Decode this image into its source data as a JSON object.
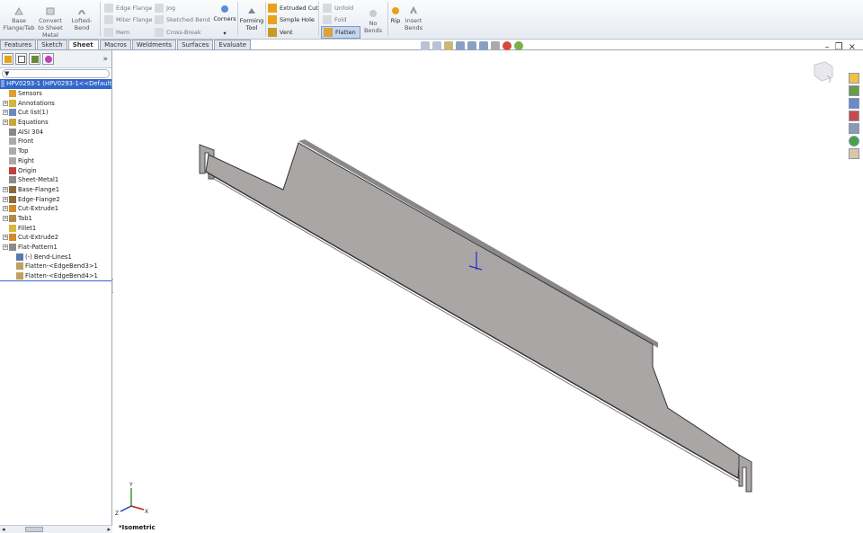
{
  "ribbon": {
    "big_buttons": [
      {
        "label": "Base Flange/Tab",
        "icon": "base-flange-icon"
      },
      {
        "label": "Convert to Sheet Metal",
        "icon": "convert-icon"
      },
      {
        "label": "Lofted-Bend",
        "icon": "lofted-bend-icon"
      }
    ],
    "col1": [
      "Edge Flange",
      "Miter Flange",
      "Hem"
    ],
    "col2": [
      "Jog",
      "Sketched Bend",
      "Cross-Break"
    ],
    "corners": "Corners",
    "forming_tool": "Forming Tool",
    "col3": [
      "Extruded Cut",
      "Simple Hole",
      "Vent"
    ],
    "col4": [
      "Unfold",
      "Fold",
      "Flatten"
    ],
    "no_bends": "No Bends",
    "rip": "Rip",
    "insert_bends": "Insert Bends"
  },
  "tabs": [
    "Features",
    "Sketch",
    "Sheet Metal",
    "Macros",
    "Weldments",
    "Surfaces",
    "Evaluate"
  ],
  "active_tab": "Sheet Metal",
  "panel": {
    "more": "»",
    "root": "HPV0293-1 (HPV0293-1<<Default",
    "items": [
      {
        "label": "Sensors",
        "icon": "sensors-icon",
        "exp": false
      },
      {
        "label": "Annotations",
        "icon": "annotations-icon",
        "exp": true
      },
      {
        "label": "Cut list(1)",
        "icon": "cutlist-icon",
        "exp": true
      },
      {
        "label": "Equations",
        "icon": "equations-icon",
        "exp": true
      },
      {
        "label": "AISI 304",
        "icon": "material-icon",
        "exp": false
      },
      {
        "label": "Front",
        "icon": "plane-icon",
        "exp": false
      },
      {
        "label": "Top",
        "icon": "plane-icon",
        "exp": false
      },
      {
        "label": "Right",
        "icon": "plane-icon",
        "exp": false
      },
      {
        "label": "Origin",
        "icon": "origin-icon",
        "exp": false
      },
      {
        "label": "Sheet-Metal1",
        "icon": "sheetmetal-icon",
        "exp": false
      },
      {
        "label": "Base-Flange1",
        "icon": "flange-icon",
        "exp": true
      },
      {
        "label": "Edge-Flange2",
        "icon": "flange-icon",
        "exp": true
      },
      {
        "label": "Cut-Extrude1",
        "icon": "cut-icon",
        "exp": true
      },
      {
        "label": "Tab1",
        "icon": "tab-icon",
        "exp": true
      },
      {
        "label": "Fillet1",
        "icon": "fillet-icon",
        "exp": false
      },
      {
        "label": "Cut-Extrude2",
        "icon": "cut-icon",
        "exp": true
      },
      {
        "label": "Flat-Pattern1",
        "icon": "flatpattern-icon",
        "exp": true
      }
    ],
    "children": [
      "(-) Bend-Lines1",
      "Flatten-<EdgeBend3>1",
      "Flatten-<EdgeBend4>1"
    ]
  },
  "graphics": {
    "view_name": "*Isometric",
    "triad": {
      "x": "X",
      "y": "Y",
      "z": "Z"
    }
  },
  "colors": {
    "part": "#a9a6a5",
    "selection": "#3366cc",
    "accent": "#e8a21a"
  }
}
